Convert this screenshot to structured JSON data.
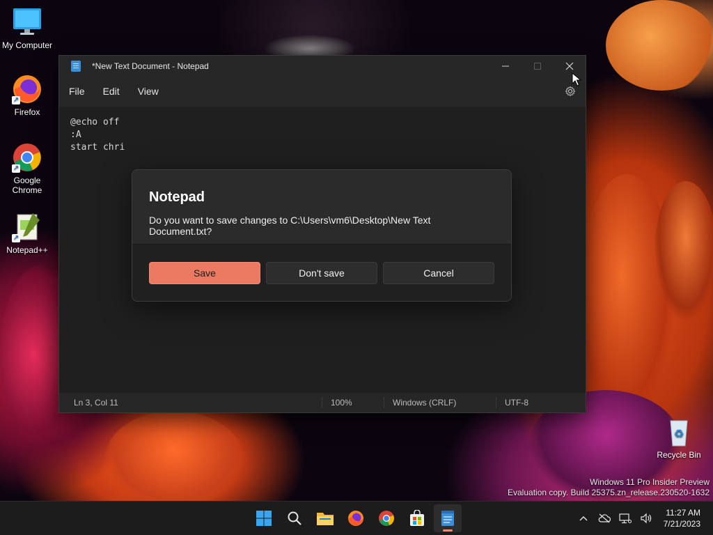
{
  "desktop": {
    "icons": [
      {
        "label": "My Computer"
      },
      {
        "label": "Firefox"
      },
      {
        "label": "Google Chrome"
      },
      {
        "label": "Notepad++"
      },
      {
        "label": "Recycle Bin"
      }
    ],
    "watermark": {
      "line1": "Windows 11 Pro Insider Preview",
      "line2": "Evaluation copy. Build 25375.zn_release.230520-1632"
    }
  },
  "notepad": {
    "title": "*New Text Document - Notepad",
    "menu": [
      "File",
      "Edit",
      "View"
    ],
    "content": "@echo off\n:A\nstart chri",
    "status": {
      "position": "Ln 3, Col 11",
      "zoom": "100%",
      "line_ending": "Windows (CRLF)",
      "encoding": "UTF-8"
    },
    "window_controls": {
      "minimize": "minimize",
      "maximize": "maximize",
      "close": "close"
    }
  },
  "dialog": {
    "title": "Notepad",
    "message": "Do you want to save changes to C:\\Users\\vm6\\Desktop\\New Text Document.txt?",
    "buttons": {
      "save": "Save",
      "dont_save": "Don't save",
      "cancel": "Cancel"
    }
  },
  "taskbar": {
    "apps": [
      "start",
      "search",
      "file-explorer",
      "firefox",
      "chrome",
      "microsoft-store",
      "notepad"
    ],
    "active_app": "notepad",
    "clock": {
      "time": "11:27 AM",
      "date": "7/21/2023"
    }
  },
  "colors": {
    "accent": "#ec7a62",
    "window_bg": "#272727",
    "editor_bg": "#1f1f1f",
    "taskbar_bg": "#1c1c1c"
  }
}
